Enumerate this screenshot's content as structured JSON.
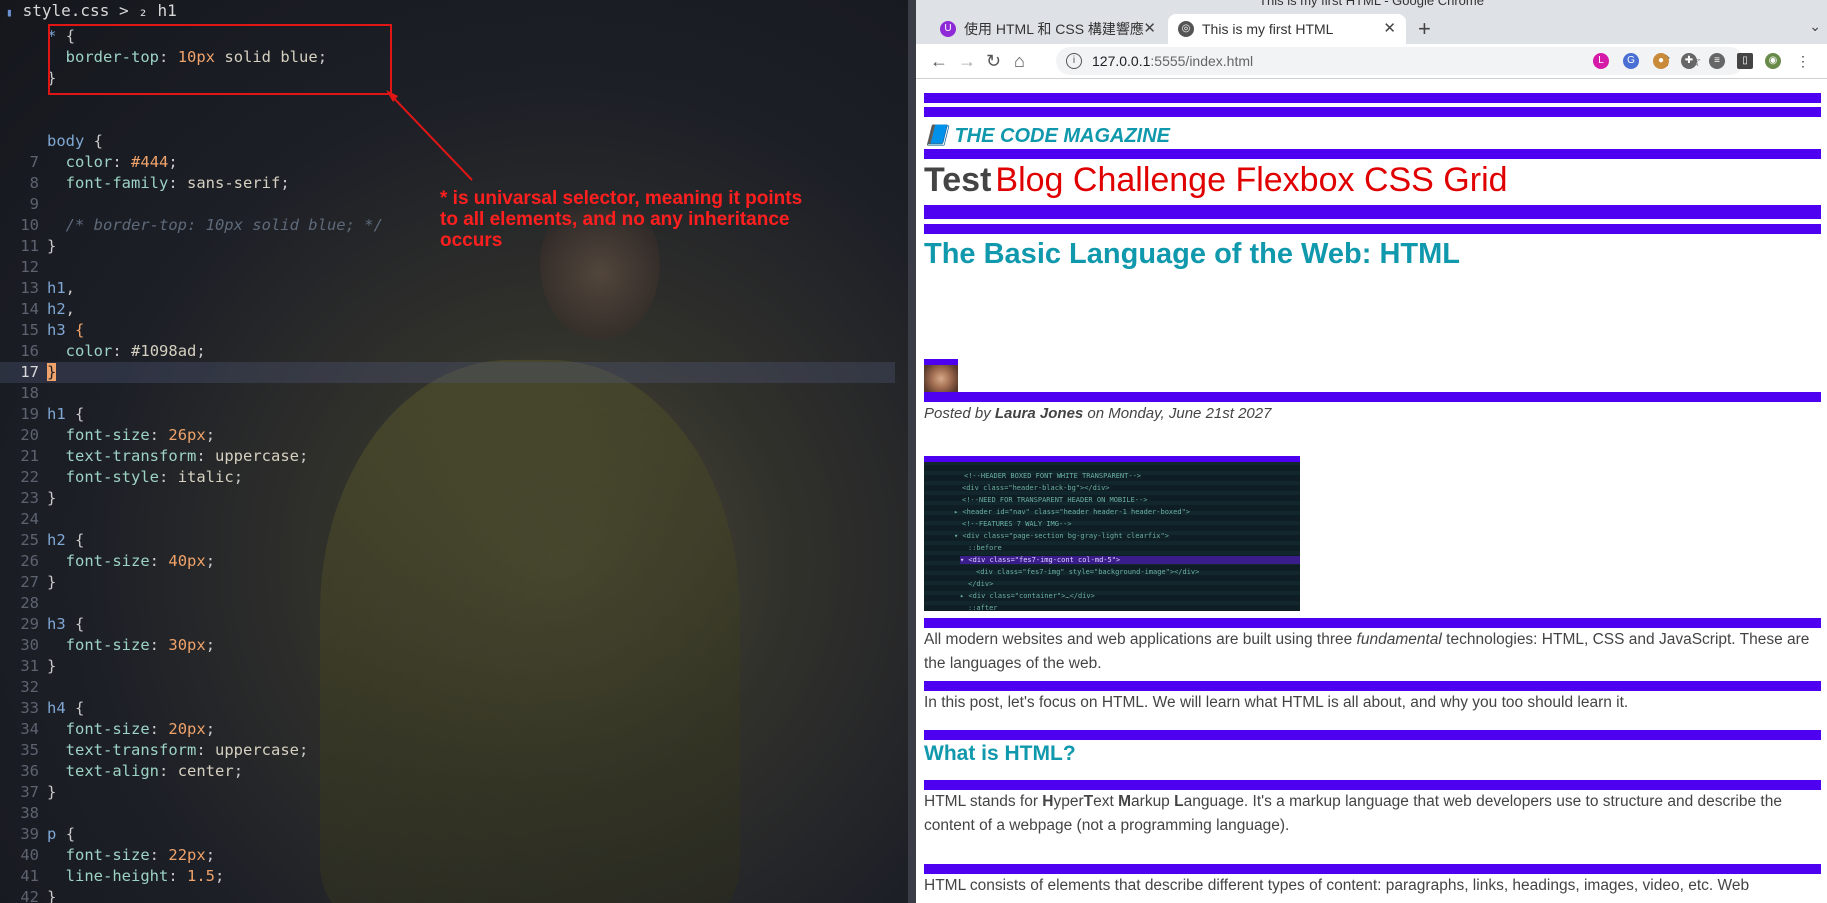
{
  "editor": {
    "breadcrumb": "style.css > ₂ h1",
    "lines": [
      {
        "n": "",
        "html": "<span class=\"sel\">*</span> <span class=\"pun\">{</span>"
      },
      {
        "n": "",
        "html": "  <span class=\"prop\">border-top</span><span class=\"pun\">:</span> <span class=\"num\">10px</span> <span class=\"val\">solid blue</span><span class=\"pun\">;</span>"
      },
      {
        "n": "",
        "html": "<span class=\"pun\">}</span>"
      },
      {
        "n": "",
        "html": ""
      },
      {
        "n": "",
        "html": ""
      },
      {
        "n": "",
        "html": "<span class=\"sel\">body</span> <span class=\"pun\">{</span>"
      },
      {
        "n": "7",
        "html": "  <span class=\"prop\">color</span><span class=\"pun\">:</span> <span class=\"num\">#444</span><span class=\"pun\">;</span>"
      },
      {
        "n": "8",
        "html": "  <span class=\"prop\">font-family</span><span class=\"pun\">:</span> <span class=\"val\">sans-serif</span><span class=\"pun\">;</span>"
      },
      {
        "n": "9",
        "html": ""
      },
      {
        "n": "10",
        "html": "  <span class=\"cmt\">/* border-top: 10px solid blue; */</span>"
      },
      {
        "n": "11",
        "html": "<span class=\"pun\">}</span>"
      },
      {
        "n": "12",
        "html": ""
      },
      {
        "n": "13",
        "html": "<span class=\"sel\">h1</span><span class=\"pun\">,</span>"
      },
      {
        "n": "14",
        "html": "<span class=\"sel\">h2</span><span class=\"pun\">,</span>"
      },
      {
        "n": "15",
        "html": "<span class=\"sel\">h3</span> <span class=\"num\">{</span>"
      },
      {
        "n": "16",
        "html": "  <span class=\"prop\">color</span><span class=\"pun\">:</span> <span class=\"val\">#1098ad</span><span class=\"pun\">;</span>"
      },
      {
        "n": "17",
        "html": "<span class=\"brace-cur\">}</span>",
        "current": true
      },
      {
        "n": "18",
        "html": ""
      },
      {
        "n": "19",
        "html": "<span class=\"sel\">h1</span> <span class=\"pun\">{</span>"
      },
      {
        "n": "20",
        "html": "  <span class=\"prop\">font-size</span><span class=\"pun\">:</span> <span class=\"num\">26px</span><span class=\"pun\">;</span>"
      },
      {
        "n": "21",
        "html": "  <span class=\"prop\">text-transform</span><span class=\"pun\">:</span> <span class=\"val\">uppercase</span><span class=\"pun\">;</span>"
      },
      {
        "n": "22",
        "html": "  <span class=\"prop\">font-style</span><span class=\"pun\">:</span> <span class=\"val\">italic</span><span class=\"pun\">;</span>"
      },
      {
        "n": "23",
        "html": "<span class=\"pun\">}</span>"
      },
      {
        "n": "24",
        "html": ""
      },
      {
        "n": "25",
        "html": "<span class=\"sel\">h2</span> <span class=\"pun\">{</span>"
      },
      {
        "n": "26",
        "html": "  <span class=\"prop\">font-size</span><span class=\"pun\">:</span> <span class=\"num\">40px</span><span class=\"pun\">;</span>"
      },
      {
        "n": "27",
        "html": "<span class=\"pun\">}</span>"
      },
      {
        "n": "28",
        "html": ""
      },
      {
        "n": "29",
        "html": "<span class=\"sel\">h3</span> <span class=\"pun\">{</span>"
      },
      {
        "n": "30",
        "html": "  <span class=\"prop\">font-size</span><span class=\"pun\">:</span> <span class=\"num\">30px</span><span class=\"pun\">;</span>"
      },
      {
        "n": "31",
        "html": "<span class=\"pun\">}</span>"
      },
      {
        "n": "32",
        "html": ""
      },
      {
        "n": "33",
        "html": "<span class=\"sel\">h4</span> <span class=\"pun\">{</span>"
      },
      {
        "n": "34",
        "html": "  <span class=\"prop\">font-size</span><span class=\"pun\">:</span> <span class=\"num\">20px</span><span class=\"pun\">;</span>"
      },
      {
        "n": "35",
        "html": "  <span class=\"prop\">text-transform</span><span class=\"pun\">:</span> <span class=\"val\">uppercase</span><span class=\"pun\">;</span>"
      },
      {
        "n": "36",
        "html": "  <span class=\"prop\">text-align</span><span class=\"pun\">:</span> <span class=\"val\">center</span><span class=\"pun\">;</span>"
      },
      {
        "n": "37",
        "html": "<span class=\"pun\">}</span>"
      },
      {
        "n": "38",
        "html": ""
      },
      {
        "n": "39",
        "html": "<span class=\"sel\">p</span> <span class=\"pun\">{</span>"
      },
      {
        "n": "40",
        "html": "  <span class=\"prop\">font-size</span><span class=\"pun\">:</span> <span class=\"num\">22px</span><span class=\"pun\">;</span>"
      },
      {
        "n": "41",
        "html": "  <span class=\"prop\">line-height</span><span class=\"pun\">:</span> <span class=\"num\">1.5</span><span class=\"pun\">;</span>"
      },
      {
        "n": "42",
        "html": "<span class=\"pun\">}</span>"
      }
    ],
    "annotation": "* is univarsal selector, meaning it points to all elements, and no any inheritance occurs"
  },
  "browser": {
    "window_title": "This is my first HTML - Google Chrome",
    "tabs": [
      {
        "label": "使用 HTML 和 CSS 構建響應",
        "active": false
      },
      {
        "label": "This is my first HTML",
        "active": true
      }
    ],
    "new_tab": "+",
    "tab_menu": "⌄",
    "url_host": "127.0.0.1",
    "url_rest": ":5555/index.html",
    "accent_color": "#4e00f0"
  },
  "page": {
    "magazine": "📘 The Code Magazine",
    "test_word": "Test",
    "nav_links": "Blog Challenge Flexbox CSS Grid",
    "h2": "The Basic Language of the Web: HTML",
    "posted_prefix": "Posted by ",
    "author": "Laura Jones",
    "posted_suffix": " on Monday, June 21st 2027",
    "p1_a": "All modern websites and web applications are built using three ",
    "p1_em": "fundamental",
    "p1_b": " technologies: HTML, CSS and JavaScript. These are the languages of the web.",
    "p2": "In this post, let's focus on HTML. We will learn what HTML is all about, and why you too should learn it.",
    "h3": "What is HTML?",
    "p3_parts": [
      "HTML stands for ",
      "H",
      "yper",
      "T",
      "ext ",
      "M",
      "arkup ",
      "L",
      "anguage. It's a markup language that web developers use to structure and describe the content of a webpage (not a programming language)."
    ],
    "p4": "HTML consists of elements that describe different types of content: paragraphs, links, headings, images, video, etc. Web"
  }
}
